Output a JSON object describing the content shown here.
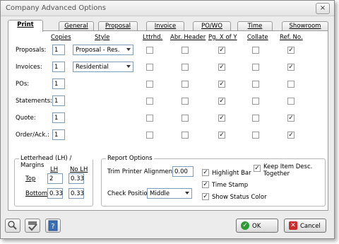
{
  "window": {
    "title": "Company Advanced Options",
    "close_glyph": "×"
  },
  "tabs": [
    "Print",
    "General",
    "Proposal",
    "Invoice",
    "PO/WO",
    "Time",
    "Showroom"
  ],
  "columns": {
    "copies": "Copies",
    "style": "Style",
    "lttrhd": "Lttrhd.",
    "abr_header": "Abr. Header",
    "pg_x_of_y": "Pg. X of Y",
    "collate": "Collate",
    "ref_no": "Ref. No."
  },
  "rows": [
    {
      "label": "Proposals:",
      "copies": "1",
      "style": "Proposal - Res.",
      "lttrhd": false,
      "abr": false,
      "pg": true,
      "collate": false,
      "ref": true
    },
    {
      "label": "Invoices:",
      "copies": "1",
      "style": "Residential",
      "lttrhd": false,
      "abr": false,
      "pg": true,
      "collate": false,
      "ref": true
    },
    {
      "label": "POs:",
      "copies": "1",
      "style": "",
      "lttrhd": false,
      "abr": false,
      "pg": true,
      "collate": false,
      "ref": false
    },
    {
      "label": "Statements:",
      "copies": "1",
      "style": "",
      "lttrhd": false,
      "abr": false,
      "pg": true,
      "collate": false,
      "ref": false
    },
    {
      "label": "Quote:",
      "copies": "1",
      "style": "",
      "lttrhd": false,
      "abr": false,
      "pg": true,
      "collate": false,
      "ref": true
    },
    {
      "label": "Order/Ack.:",
      "copies": "1",
      "style": "",
      "lttrhd": false,
      "abr": false,
      "pg": true,
      "collate": false,
      "ref": true
    }
  ],
  "letterhead": {
    "title": "Letterhead (LH) / Margins",
    "lh_header": "LH",
    "nolh_header": "No LH",
    "top_label": "Top",
    "bottom_label": "Bottom",
    "top_lh": "2",
    "top_nolh": "0.33",
    "bottom_lh": "0.33",
    "bottom_nolh": "0.33"
  },
  "report": {
    "title": "Report Options",
    "trim_label": "Trim Printer Alignment",
    "trim_value": "0.00",
    "check_label": "Check Position",
    "check_value": "Middle",
    "highlight_bar": "Highlight Bar",
    "time_stamp": "Time Stamp",
    "show_status": "Show Status Color",
    "keep_item_1": "Keep Item Desc.",
    "keep_item_2": "Together"
  },
  "buttons": {
    "ok": "OK",
    "cancel": "Cancel"
  },
  "check_mark": "✓",
  "icons": [
    "magnifier-icon",
    "abc-check-icon",
    "help-icon",
    "ok-icon",
    "cancel-icon"
  ]
}
